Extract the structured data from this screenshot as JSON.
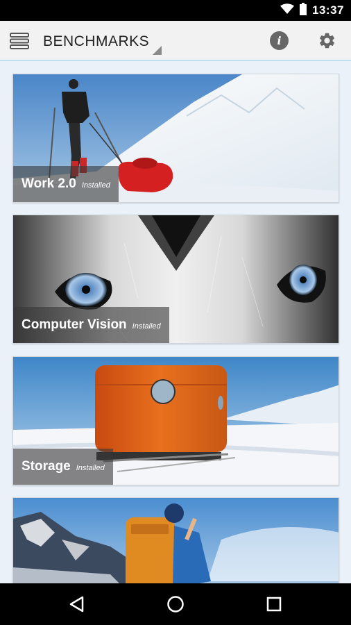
{
  "status_bar": {
    "time": "13:37"
  },
  "app_bar": {
    "title": "BENCHMARKS",
    "info_glyph": "i"
  },
  "cards": [
    {
      "name": "Work 2.0",
      "status": "Installed"
    },
    {
      "name": "Computer Vision",
      "status": "Installed"
    },
    {
      "name": "Storage",
      "status": "Installed"
    },
    {
      "name": "",
      "status": ""
    }
  ],
  "icons": {
    "wifi": "wifi-icon",
    "battery": "battery-icon",
    "menu": "menu-icon",
    "dropdown": "dropdown-triangle-icon",
    "info": "info-icon",
    "settings": "gear-icon",
    "back": "back-triangle-icon",
    "home": "home-circle-icon",
    "recents": "recents-square-icon"
  },
  "colors": {
    "app_bar_bg": "#f2f2f2",
    "accent_line": "#bfe0f2",
    "page_bg": "#eaf1f8",
    "label_overlay": "#373737"
  }
}
